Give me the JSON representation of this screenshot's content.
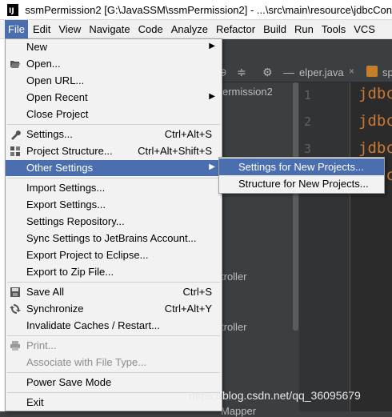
{
  "window": {
    "title": "ssmPermission2 [G:\\JavaSSM\\ssmPermission2] - ...\\src\\main\\resource\\jdbcCon",
    "app_icon_text": "IJ"
  },
  "menubar": {
    "items": [
      "File",
      "Edit",
      "View",
      "Navigate",
      "Code",
      "Analyze",
      "Refactor",
      "Build",
      "Run",
      "Tools",
      "VCS"
    ],
    "active": "File"
  },
  "background": {
    "project_name": "ermission2",
    "tree_fragments": [
      "troller",
      "troller",
      "Mapper"
    ],
    "tabs": [
      {
        "label": "elper.java",
        "close": "×"
      },
      {
        "label": "sp"
      }
    ],
    "line_numbers": [
      "1",
      "2",
      "3"
    ],
    "code_lines": [
      "jdbc",
      "jdbc",
      "jdbc",
      "jdbc"
    ]
  },
  "file_menu": {
    "items": [
      {
        "label": "New",
        "submenu": true
      },
      {
        "label": "Open...",
        "icon": "folder-open-icon"
      },
      {
        "label": "Open URL..."
      },
      {
        "label": "Open Recent",
        "submenu": true
      },
      {
        "label": "Close Project"
      },
      {
        "label": "Settings...",
        "shortcut": "Ctrl+Alt+S",
        "icon": "wrench-icon"
      },
      {
        "label": "Project Structure...",
        "shortcut": "Ctrl+Alt+Shift+S",
        "icon": "project-structure-icon"
      },
      {
        "label": "Other Settings",
        "submenu": true,
        "highlighted": true
      },
      {
        "label": "Import Settings..."
      },
      {
        "label": "Export Settings..."
      },
      {
        "label": "Settings Repository..."
      },
      {
        "label": "Sync Settings to JetBrains Account..."
      },
      {
        "label": "Export Project to Eclipse..."
      },
      {
        "label": "Export to Zip File..."
      },
      {
        "label": "Save All",
        "shortcut": "Ctrl+S",
        "icon": "save-icon"
      },
      {
        "label": "Synchronize",
        "shortcut": "Ctrl+Alt+Y",
        "icon": "sync-icon"
      },
      {
        "label": "Invalidate Caches / Restart..."
      },
      {
        "label": "Print...",
        "disabled": true,
        "icon": "print-icon"
      },
      {
        "label": "Associate with File Type...",
        "disabled": true
      },
      {
        "label": "Power Save Mode"
      },
      {
        "label": "Exit"
      }
    ]
  },
  "other_settings_submenu": {
    "items": [
      {
        "label": "Settings for New Projects...",
        "highlighted": true
      },
      {
        "label": "Structure for New Projects..."
      }
    ]
  },
  "watermark": "https://blog.csdn.net/qq_36095679",
  "colors": {
    "highlight": "#4b6eaf",
    "menu_bg": "#f2f2f2",
    "ide_bg": "#3c3f41",
    "editor_bg": "#2b2b2b",
    "keyword": "#cc7832"
  }
}
